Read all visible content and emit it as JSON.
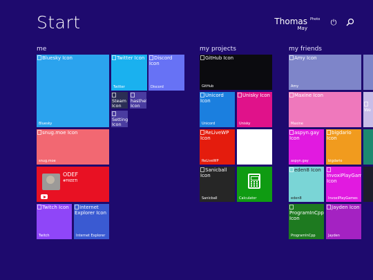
{
  "header": {
    "title": "Start",
    "user_first": "Thomas",
    "user_last": "May",
    "photo_alt": "Photo"
  },
  "groups": {
    "me": "me",
    "projects": "my projects",
    "friends": "my friends"
  },
  "tiles": {
    "bluesky": {
      "icon_alt": "Bluesky Icon",
      "label": "Bluesky",
      "color": "#2ba3ee"
    },
    "twitter": {
      "icon_alt": "Twitter Icon",
      "label": "Twitter",
      "color": "#1ab1ef"
    },
    "discord": {
      "icon_alt": "Discord Icon",
      "label": "Discord",
      "color": "#6772f5"
    },
    "steam": {
      "icon_alt": "Steam Icon",
      "color": "#2b2e55"
    },
    "hastheb": {
      "icon_alt": "hasthebi Icon",
      "color": "#4a3ca0"
    },
    "settings": {
      "icon_alt": "Settings Icon",
      "color": "#4a3ca0"
    },
    "snug": {
      "icon_alt": "snug.moe Icon",
      "label": "snug.moe",
      "color": "#f26872"
    },
    "odef": {
      "name": "ODEF",
      "tag": "#FREETI",
      "color": "#e81123"
    },
    "twitch": {
      "icon_alt": "Twitch Icon",
      "label": "Twitch",
      "color": "#8f46f8"
    },
    "ie": {
      "icon_alt": "Internet Explorer Icon",
      "label": "Internet Explorer",
      "color": "#3a5ad2"
    },
    "github": {
      "icon_alt": "GitHub Icon",
      "label": "GitHub",
      "color": "#0b0b0f"
    },
    "unicord": {
      "icon_alt": "Unicord Icon",
      "label": "Unicord",
      "color": "#1b7fdf"
    },
    "unisky": {
      "icon_alt": "Unisky Icon",
      "label": "Unisky",
      "color": "#e0128a"
    },
    "relivewp": {
      "icon_alt": "ReLiveWP Icon",
      "label": "ReLiveWP",
      "color": "#e41c0d"
    },
    "blank": {
      "icon_alt": "",
      "color": "#ffffff"
    },
    "sanicball": {
      "icon_alt": "Sanicball Icon",
      "label": "Sanicball",
      "color": "#262626"
    },
    "calculator": {
      "label": "Calculator",
      "color": "#0f9b12"
    },
    "amy": {
      "icon_alt": "Amy Icon",
      "label": "Amy",
      "color": "#7e85c9"
    },
    "amy_peek": {
      "color": "#7e85c9"
    },
    "maxine": {
      "icon_alt": "Maxine Icon",
      "label": "Maxine",
      "color": "#ef78bc"
    },
    "maxine_peek": {
      "icon_alt": "We",
      "color": "#c8bde8"
    },
    "aspyn": {
      "icon_alt": "aspyn.gay Icon",
      "label": "aspyn.gay",
      "color": "#e11ae0"
    },
    "bigdario": {
      "icon_alt": "bigdario Icon",
      "label": "bigdario",
      "color": "#f19b1e"
    },
    "bigdario_peek": {
      "color": "#1d8a70"
    },
    "eden8": {
      "icon_alt": "eden8 Icon",
      "label": "eden8",
      "color": "#7ad5d6"
    },
    "invoxi": {
      "icon_alt": "InvoxiPlayGames Icon",
      "label": "InvoxiPlayGames",
      "color": "#e11ae0"
    },
    "invoxi_peek": {
      "color": "#1d1d2a"
    },
    "programincpp": {
      "icon_alt": "ProgramInCpp Icon",
      "label": "ProgramInCpp",
      "color": "#1e7a20"
    },
    "jayden": {
      "icon_alt": "Jayden Icon",
      "label": "Jayden",
      "color": "#a422c2"
    }
  },
  "icons": [
    "power-icon",
    "search-icon",
    "youtube-icon",
    "calculator-icon"
  ]
}
